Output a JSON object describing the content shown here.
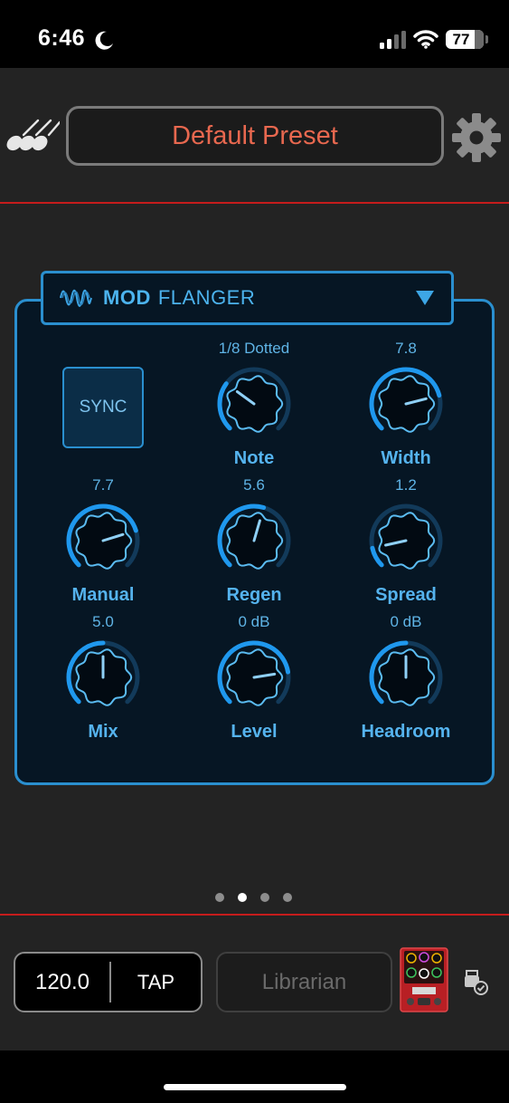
{
  "status_bar": {
    "time": "6:46",
    "battery": "77",
    "battery_fraction": 0.77
  },
  "header": {
    "preset_name": "Default Preset"
  },
  "effect": {
    "type": "MOD",
    "name": "FLANGER",
    "sync_label": "SYNC",
    "accent_color": "#2a8fcf",
    "knobs": [
      {
        "label": "Note",
        "value": "1/8 Dotted",
        "fraction": 0.3
      },
      {
        "label": "Width",
        "value": "7.8",
        "fraction": 0.78
      },
      {
        "label": "Manual",
        "value": "7.7",
        "fraction": 0.77
      },
      {
        "label": "Regen",
        "value": "5.6",
        "fraction": 0.56
      },
      {
        "label": "Spread",
        "value": "1.2",
        "fraction": 0.12
      },
      {
        "label": "Mix",
        "value": "5.0",
        "fraction": 0.5
      },
      {
        "label": "Level",
        "value": "0 dB",
        "fraction": 0.8
      },
      {
        "label": "Headroom",
        "value": "0 dB",
        "fraction": 0.5
      }
    ]
  },
  "pager": {
    "pages": 4,
    "active_page": 2
  },
  "footer": {
    "tempo": "120.0",
    "tap_label": "TAP",
    "librarian_label": "Librarian",
    "brand_color": "#c51c1c"
  },
  "icons": [
    "moon-icon",
    "signal-icon",
    "wifi-icon",
    "battery-icon",
    "guitars-icon",
    "gear-icon",
    "wave-icon",
    "dropdown-icon",
    "pedal-thumbnail",
    "usb-connected-icon"
  ]
}
